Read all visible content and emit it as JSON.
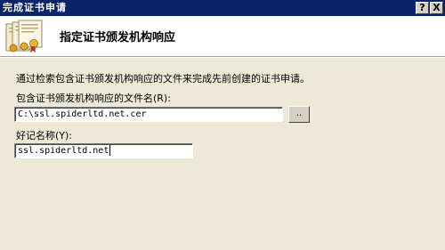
{
  "window": {
    "title": "完成证书申请",
    "help_button": "?",
    "close_button": "X"
  },
  "header": {
    "title": "指定证书颁发机构响应",
    "icon": "certificate-stack-icon"
  },
  "body": {
    "description": "通过检索包含证书颁发机构响应的文件来完成先前创建的证书申请。",
    "file_label": "包含证书颁发机构响应的文件名(R):",
    "file_value": "C:\\ssl.spiderltd.net.cer",
    "browse_label": "..",
    "friendly_name_label": "好记名称(Y):",
    "friendly_name_value": "ssl.spiderltd.net"
  },
  "colors": {
    "titlebar": "#0a246a",
    "dialog_bg": "#ece9d8",
    "header_bg": "#ffffff"
  }
}
